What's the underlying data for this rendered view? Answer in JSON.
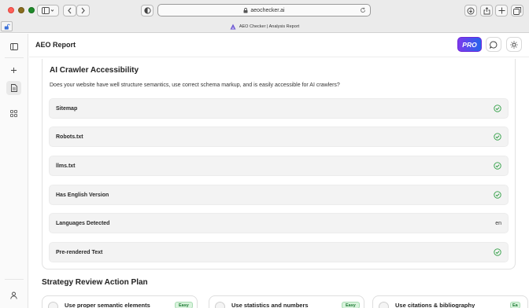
{
  "browser": {
    "url": "aeochecker.ai",
    "tab_title": "AEO Checker | Analysis Report"
  },
  "header": {
    "title": "AEO Report",
    "pro_label": "PRO"
  },
  "crawler_section": {
    "title": "AI Crawler Accessibility",
    "description": "Does your website have well structure semantics, use correct schema markup, and is easily accessible for AI crawlers?",
    "items": [
      {
        "label": "Sitemap",
        "status": "check"
      },
      {
        "label": "Robots.txt",
        "status": "check"
      },
      {
        "label": "llms.txt",
        "status": "check"
      },
      {
        "label": "Has English Version",
        "status": "check"
      },
      {
        "label": "Languages Detected",
        "value": "en"
      },
      {
        "label": "Pre-rendered Text",
        "status": "check"
      }
    ]
  },
  "strategy_section": {
    "title": "Strategy Review Action Plan",
    "actions": [
      {
        "title": "Use proper semantic elements",
        "badge": "Easy"
      },
      {
        "title": "Use statistics and numbers",
        "badge": "Easy"
      },
      {
        "title": "Use citations & bibliography",
        "badge": "Ea"
      }
    ]
  },
  "colors": {
    "check": "#2f9e44",
    "pro_gradient_start": "#7c3aed",
    "pro_gradient_end": "#2563eb",
    "easy_badge": "#d8f3dc"
  }
}
